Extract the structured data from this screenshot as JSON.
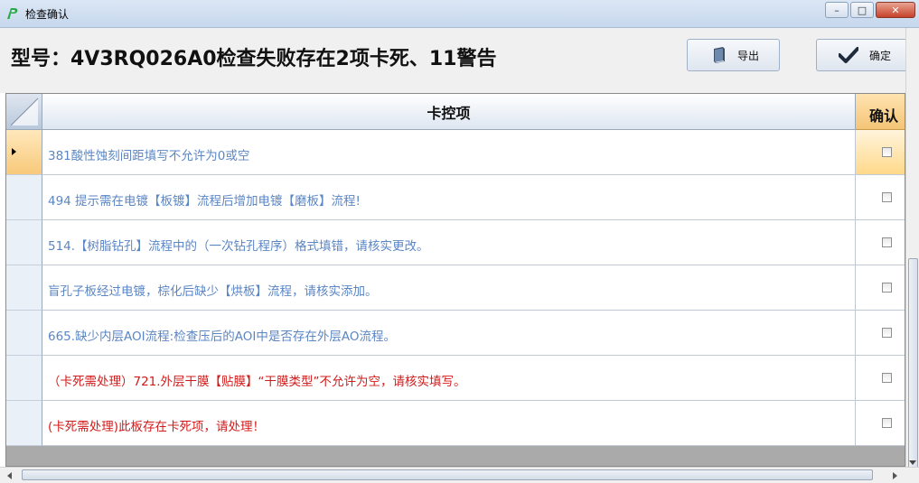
{
  "window": {
    "title": "检查确认"
  },
  "header": {
    "heading": "型号：4V3RQ026A0检查失败存在2项卡死、11警告"
  },
  "toolbar": {
    "export_label": "导出",
    "confirm_label": "确定"
  },
  "grid": {
    "columns": [
      "卡控项",
      "确认"
    ],
    "rows": [
      {
        "text": "381酸性蚀刻间距填写不允许为0或空",
        "color": "blue",
        "checked": false,
        "current": true
      },
      {
        "text": "494 提示需在电镀【板镀】流程后增加电镀【磨板】流程!",
        "color": "blue",
        "checked": false,
        "current": false
      },
      {
        "text": "514.【树脂钻孔】流程中的（一次钻孔程序）格式填错，请核实更改。",
        "color": "blue",
        "checked": false,
        "current": false
      },
      {
        "text": "盲孔子板经过电镀，棕化后缺少【烘板】流程，请核实添加。",
        "color": "blue",
        "checked": false,
        "current": false
      },
      {
        "text": "665.缺少内层AOI流程:检查压后的AOI中是否存在外层AO流程。",
        "color": "blue",
        "checked": false,
        "current": false
      },
      {
        "text": "（卡死需处理）721.外层干膜【贴膜】“干膜类型”不允许为空，请核实填写。",
        "color": "red",
        "checked": false,
        "current": false
      },
      {
        "text": "(卡死需处理)此板存在卡死项，请处理！",
        "color": "red",
        "checked": false,
        "current": false
      }
    ]
  },
  "colors": {
    "warning_text": "#5b86c4",
    "blocking_text": "#d21a1a",
    "current_row": "#f8c97a"
  }
}
